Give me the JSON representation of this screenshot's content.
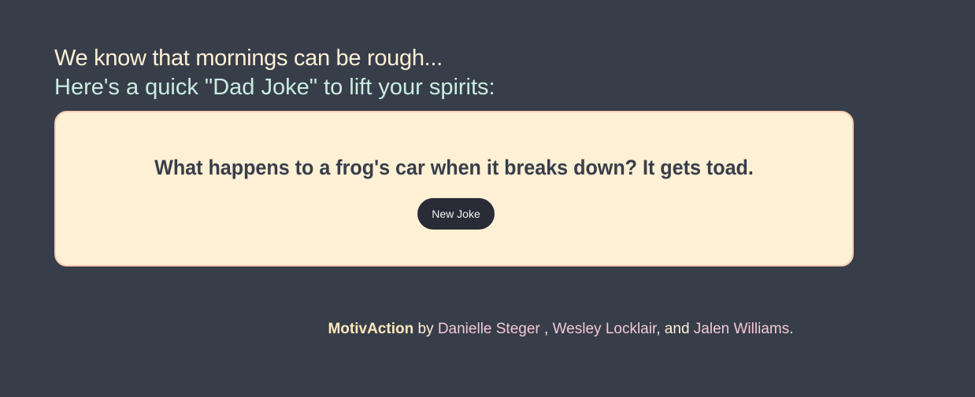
{
  "header": {
    "headline": "We know that mornings can be rough...",
    "subheadline": "Here's a quick \"Dad Joke\" to lift your spirits:"
  },
  "joke_card": {
    "joke": "What happens to a frog's car when it breaks down? It gets toad.",
    "new_joke_label": "New Joke"
  },
  "footer": {
    "brand": "MotivAction",
    "by": " by ",
    "author_1": "Danielle Steger",
    "sep_1": " , ",
    "author_2": "Wesley Locklair",
    "sep_2": ", and ",
    "author_3": "Jalen Williams",
    "end": "."
  },
  "colors": {
    "background": "#383d4a",
    "card_background": "#fef0d5",
    "card_border": "#f6cdb4",
    "headline": "#fdf0d5",
    "subheadline": "#c8ede1",
    "button_background": "#292c36",
    "author_link": "#f4c8d6"
  }
}
